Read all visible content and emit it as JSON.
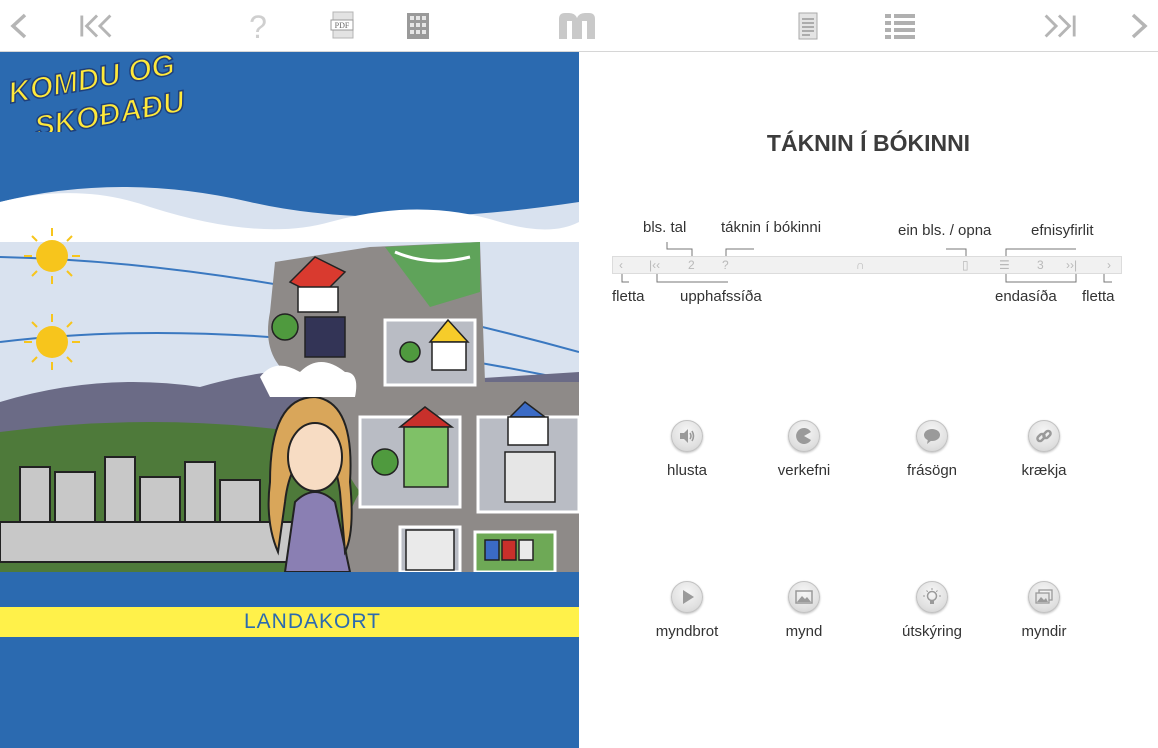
{
  "toolbar": {
    "items": [
      {
        "name": "prev-page",
        "icon": "chevron-left-icon"
      },
      {
        "name": "first-page",
        "icon": "double-chevron-left-icon"
      },
      {
        "name": "help",
        "icon": "question-icon"
      },
      {
        "name": "pdf",
        "icon": "pdf-icon",
        "label": "PDF"
      },
      {
        "name": "grid",
        "icon": "grid-icon"
      },
      {
        "name": "home",
        "icon": "m-logo-icon",
        "label": "m"
      },
      {
        "name": "single-page",
        "icon": "page-icon"
      },
      {
        "name": "contents",
        "icon": "list-icon"
      },
      {
        "name": "last-page",
        "icon": "double-chevron-right-icon"
      },
      {
        "name": "next-page",
        "icon": "chevron-right-icon"
      }
    ],
    "icon_color": "#b5b5b5"
  },
  "cover": {
    "title_line1": "KOMDU OG",
    "title_line2": "SKOÐAÐU",
    "subtitle": "LANDAKORT",
    "colors": {
      "blue": "#2b6ab0",
      "yellow": "#fff14a"
    }
  },
  "panel": {
    "title": "TÁKNIN Í BÓKINNI",
    "legend": {
      "bls_tal": "bls. tal",
      "taknin": "táknin í bókinni",
      "ein_bls": "ein bls. / opna",
      "efnisyfirlit": "efnisyfirlit",
      "fletta_left": "fletta",
      "upphafssida": "upphafssíða",
      "endasida": "endasíða",
      "fletta_right": "fletta",
      "bar_page_left": "2",
      "bar_help": "?",
      "bar_page_right": "3"
    },
    "icons": [
      {
        "label": "hlusta",
        "icon": "speaker-icon"
      },
      {
        "label": "verkefni",
        "icon": "pacman-icon"
      },
      {
        "label": "frásögn",
        "icon": "speech-bubble-icon"
      },
      {
        "label": "krækja",
        "icon": "link-icon"
      },
      {
        "label": "myndbrot",
        "icon": "play-icon"
      },
      {
        "label": "mynd",
        "icon": "image-icon"
      },
      {
        "label": "útskýring",
        "icon": "lightbulb-icon"
      },
      {
        "label": "myndir",
        "icon": "images-icon"
      }
    ]
  }
}
